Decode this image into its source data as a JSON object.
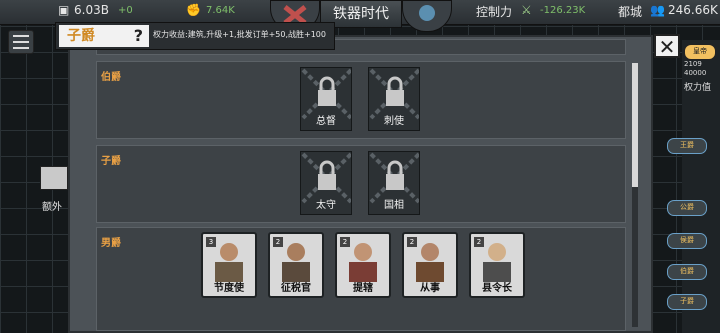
{
  "topbar": {
    "resource1": "6.03B",
    "resource1_delta": "+0",
    "resource2": "7.64K",
    "era": "铁器时代",
    "control_label": "控制力",
    "control_value": "-126.23K",
    "city_label": "都城",
    "population": "246.66K"
  },
  "tooltip": {
    "title": "子爵",
    "help": "?",
    "text": "权力收益:建筑,升级+1,批发订单+50,战胜+100"
  },
  "sections": [
    {
      "label": "伯爵",
      "slots": [
        {
          "name": "总督",
          "locked": true
        },
        {
          "name": "刺使",
          "locked": true
        }
      ]
    },
    {
      "label": "子爵",
      "slots": [
        {
          "name": "太守",
          "locked": true
        },
        {
          "name": "国相",
          "locked": true
        }
      ]
    },
    {
      "label": "男爵",
      "cards": [
        {
          "level": "3",
          "name": "节度使"
        },
        {
          "level": "2",
          "name": "征税官"
        },
        {
          "level": "2",
          "name": "提辖"
        },
        {
          "level": "2",
          "name": "从事"
        },
        {
          "level": "2",
          "name": "县令长"
        }
      ]
    }
  ],
  "right_panel": {
    "badge": "皇帝",
    "num1": "2109",
    "num2": "40000",
    "power_label": "权力值",
    "tags": [
      "王爵",
      "公爵",
      "侯爵",
      "伯爵",
      "子爵"
    ]
  },
  "left": {
    "label": "额外"
  },
  "close_label": "✕",
  "colors": {
    "rank_label": "#e8a045",
    "panel_bg": "#4c5257",
    "section_bg": "#3d4246"
  }
}
